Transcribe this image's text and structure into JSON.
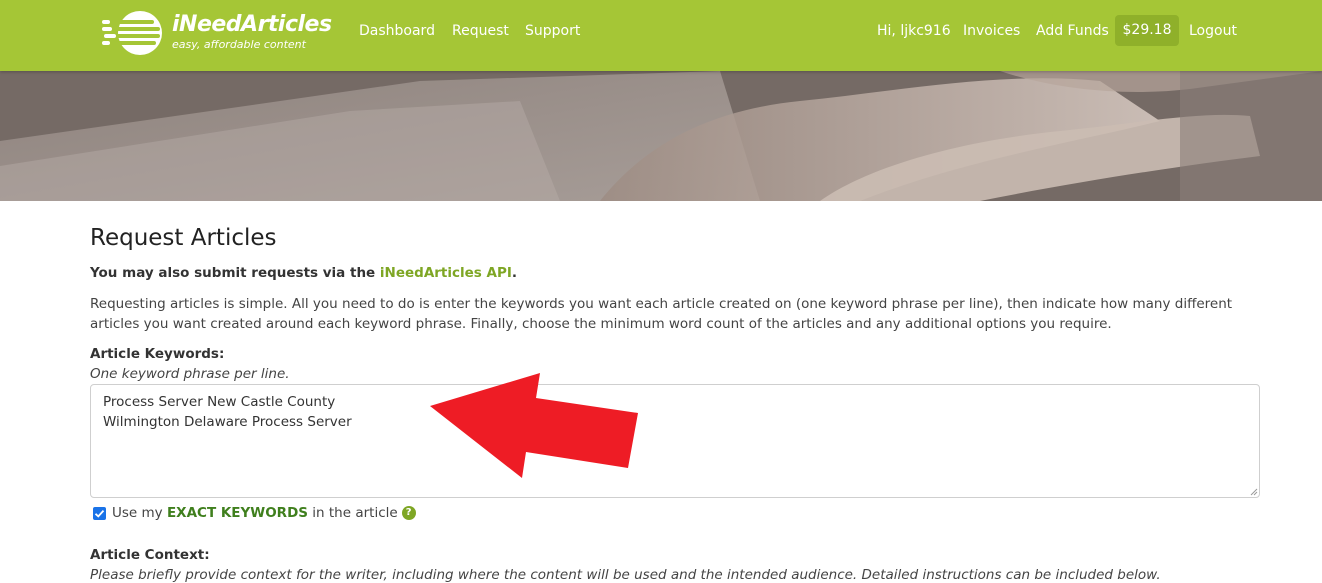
{
  "brand": {
    "name": "iNeedArticles",
    "tagline": "easy, affordable content"
  },
  "nav": {
    "left": [
      "Dashboard",
      "Request",
      "Support"
    ],
    "greeting": "Hi, ljkc916",
    "invoices": "Invoices",
    "add_funds": "Add Funds",
    "balance": "$29.18",
    "logout": "Logout"
  },
  "page": {
    "title": "Request Articles",
    "api_note_prefix": "You may also submit requests via the ",
    "api_link": "iNeedArticles API",
    "api_note_suffix": ".",
    "intro": "Requesting articles is simple. All you need to do is enter the keywords you want each article created on (one keyword phrase per line), then indicate how many different articles you want created around each keyword phrase. Finally, choose the minimum word count of the articles and any additional options you require."
  },
  "keywords": {
    "label": "Article Keywords:",
    "hint": "One keyword phrase per line.",
    "lines": [
      "Process Server New Castle County",
      "Wilmington Delaware Process Server"
    ]
  },
  "exact_keywords": {
    "checked": true,
    "prefix": "Use my ",
    "strong": "EXACT KEYWORDS",
    "suffix": " in the article",
    "help_icon": "question-circle-icon"
  },
  "context": {
    "label": "Article Context:",
    "hint": "Please briefly provide context for the writer, including where the content will be used and the intended audience. Detailed instructions can be included below."
  },
  "colors": {
    "navbar": "#a5c636",
    "balance_badge": "#8fb02a",
    "link": "#7ea624",
    "exact_keywords": "#3f7f1d",
    "annotation_arrow": "#ee1c25"
  }
}
